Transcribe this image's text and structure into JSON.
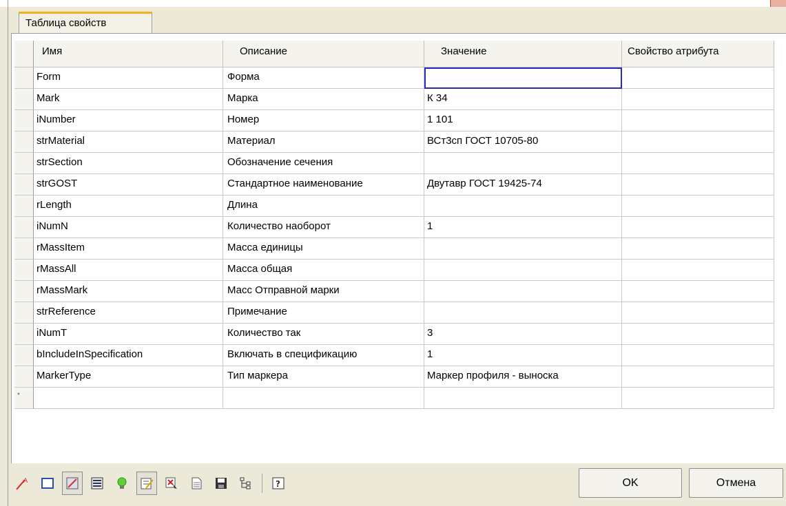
{
  "tab": {
    "label": "Таблица свойств"
  },
  "table": {
    "headers": [
      "Имя",
      "Описание",
      "Значение",
      "Свойство атрибута"
    ],
    "rows": [
      {
        "name": "Form",
        "description": "Форма",
        "value": "",
        "attribute": ""
      },
      {
        "name": "Mark",
        "description": "Марка",
        "value": "К 34",
        "attribute": ""
      },
      {
        "name": "iNumber",
        "description": "Номер",
        "value": "1 101",
        "attribute": ""
      },
      {
        "name": "strMaterial",
        "description": "Материал",
        "value": "ВСт3сп ГОСТ 10705-80",
        "attribute": ""
      },
      {
        "name": "strSection",
        "description": "Обозначение сечения",
        "value": "",
        "attribute": ""
      },
      {
        "name": "strGOST",
        "description": "Стандартное наименование",
        "value": "Двутавр ГОСТ 19425-74",
        "attribute": ""
      },
      {
        "name": "rLength",
        "description": "Длина",
        "value": "",
        "attribute": ""
      },
      {
        "name": "iNumN",
        "description": "Количество наоборот",
        "value": "1",
        "attribute": ""
      },
      {
        "name": "rMassItem",
        "description": "Масса единицы",
        "value": "",
        "attribute": ""
      },
      {
        "name": "rMassAll",
        "description": "Масса общая",
        "value": "",
        "attribute": ""
      },
      {
        "name": "rMassMark",
        "description": "Масс Отправной марки",
        "value": "",
        "attribute": ""
      },
      {
        "name": "strReference",
        "description": "Примечание",
        "value": "",
        "attribute": ""
      },
      {
        "name": "iNumT",
        "description": "Количество так",
        "value": "3",
        "attribute": ""
      },
      {
        "name": "bIncludeInSpecification",
        "description": "Включать в спецификацию",
        "value": "1",
        "attribute": ""
      },
      {
        "name": "MarkerType",
        "description": "Тип маркера",
        "value": "Маркер профиля - выноска",
        "attribute": ""
      }
    ],
    "new_row_marker": "*"
  },
  "toolbar": {
    "icons": [
      "leader-icon",
      "rectangle-icon",
      "edit-attributes-icon",
      "form-icon",
      "lightbulb-icon",
      "edit-document-icon",
      "select-delete-icon",
      "document-icon",
      "save-icon",
      "tree-icon",
      "help-icon"
    ]
  },
  "buttons": {
    "ok": "OK",
    "cancel": "Отмена"
  }
}
